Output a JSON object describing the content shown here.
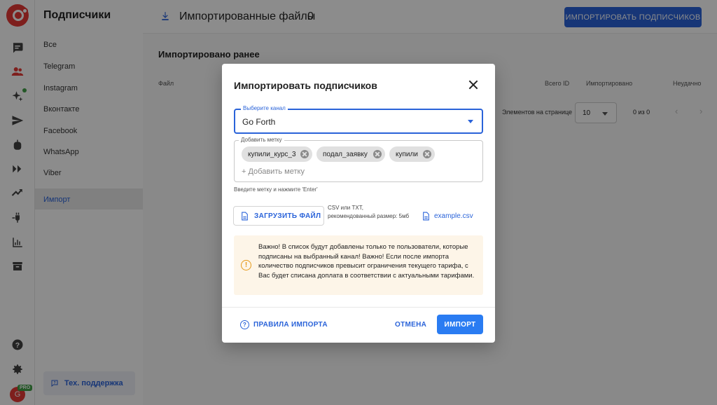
{
  "sidebar": {
    "title": "Подписчики",
    "items": [
      {
        "label": "Все"
      },
      {
        "label": "Telegram"
      },
      {
        "label": "Instagram"
      },
      {
        "label": "Вконтакте"
      },
      {
        "label": "Facebook"
      },
      {
        "label": "WhatsApp"
      },
      {
        "label": "Viber"
      },
      {
        "label": "Импорт"
      }
    ],
    "support_label": "Тех. поддержка",
    "avatar_letter": "G",
    "pro_badge": "PRO"
  },
  "topbar": {
    "title": "Импортированные файлы",
    "count": "0",
    "import_button": "ИМПОРТИРОВАТЬ ПОДПИСЧИКОВ"
  },
  "content": {
    "section_title": "Импортировано ранее",
    "columns": [
      "Файл",
      "Всего ID",
      "Импортировано",
      "Неудачно"
    ],
    "pager_label": "Элементов на странице",
    "pager_size": "10",
    "pager_range": "0 из 0"
  },
  "modal": {
    "title": "Импортировать подписчиков",
    "channel_label": "Выберите канал",
    "channel_value": "Go Forth",
    "tags_label": "Добавить метку",
    "tags": [
      "купили_курс_3",
      "подал_заявку",
      "купили"
    ],
    "tag_placeholder": "+ Добавить метку",
    "tag_helper": "Введите метку и нажмите 'Enter'",
    "upload_label": "ЗАГРУЗИТЬ ФАЙЛ",
    "file_note": "CSV или TXT, рекомендованный размер: 5мб",
    "example_link": "example.csv",
    "warning_text": "Важно! В список будут добавлены только те пользователи, которые подписаны на выбранный канал! Важно! Если после импорта количество подписчиков превысит ограничения текущего тарифа, с Вас будет списана доплата в соответствии с актуальными тарифами.",
    "rules_label": "ПРАВИЛА ИМПОРТА",
    "cancel_label": "ОТМЕНА",
    "submit_label": "ИМПОРТ"
  },
  "colors": {
    "accent": "#2a63d9",
    "brand": "#e53935",
    "warning_bg": "#fdf5e8"
  }
}
